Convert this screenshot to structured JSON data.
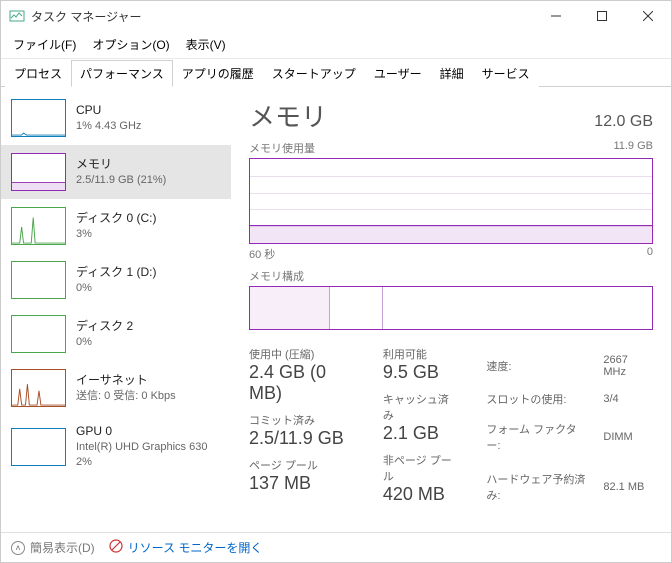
{
  "window": {
    "title": "タスク マネージャー"
  },
  "menu": {
    "file": "ファイル(F)",
    "options": "オプション(O)",
    "view": "表示(V)"
  },
  "tabs": {
    "processes": "プロセス",
    "performance": "パフォーマンス",
    "apphistory": "アプリの履歴",
    "startup": "スタートアップ",
    "users": "ユーザー",
    "details": "詳細",
    "services": "サービス"
  },
  "sidebar": [
    {
      "name": "CPU",
      "sub": "1%  4.43 GHz"
    },
    {
      "name": "メモリ",
      "sub": "2.5/11.9 GB (21%)"
    },
    {
      "name": "ディスク 0 (C:)",
      "sub": "3%"
    },
    {
      "name": "ディスク 1 (D:)",
      "sub": "0%"
    },
    {
      "name": "ディスク 2",
      "sub": "0%"
    },
    {
      "name": "イーサネット",
      "sub": "送信: 0 受信: 0 Kbps"
    },
    {
      "name": "GPU 0",
      "sub": "Intel(R) UHD Graphics 630\n2%"
    }
  ],
  "main": {
    "title": "メモリ",
    "total": "12.0 GB",
    "usage_label": "メモリ使用量",
    "usage_max": "11.9 GB",
    "axis_left": "60 秒",
    "axis_right": "0",
    "comp_label": "メモリ構成",
    "stats": {
      "inuse_label": "使用中 (圧縮)",
      "inuse": "2.4 GB (0 MB)",
      "avail_label": "利用可能",
      "avail": "9.5 GB",
      "commit_label": "コミット済み",
      "commit": "2.5/11.9 GB",
      "cached_label": "キャッシュ済み",
      "cached": "2.1 GB",
      "paged_label": "ページ プール",
      "paged": "137 MB",
      "nonpaged_label": "非ページ プール",
      "nonpaged": "420 MB"
    },
    "meta": {
      "speed_l": "速度:",
      "speed": "2667 MHz",
      "slots_l": "スロットの使用:",
      "slots": "3/4",
      "form_l": "フォーム ファクター:",
      "form": "DIMM",
      "hw_l": "ハードウェア予約済み:",
      "hw": "82.1 MB"
    }
  },
  "footer": {
    "fewer": "簡易表示(D)",
    "resmon": "リソース モニターを開く"
  },
  "chart_data": {
    "type": "area",
    "title": "メモリ使用量",
    "ylabel": "GB",
    "ylim": [
      0,
      11.9
    ],
    "xlim_seconds": [
      60,
      0
    ],
    "series": [
      {
        "name": "使用中",
        "approx_value_gb": 2.5,
        "percent": 21
      }
    ]
  }
}
